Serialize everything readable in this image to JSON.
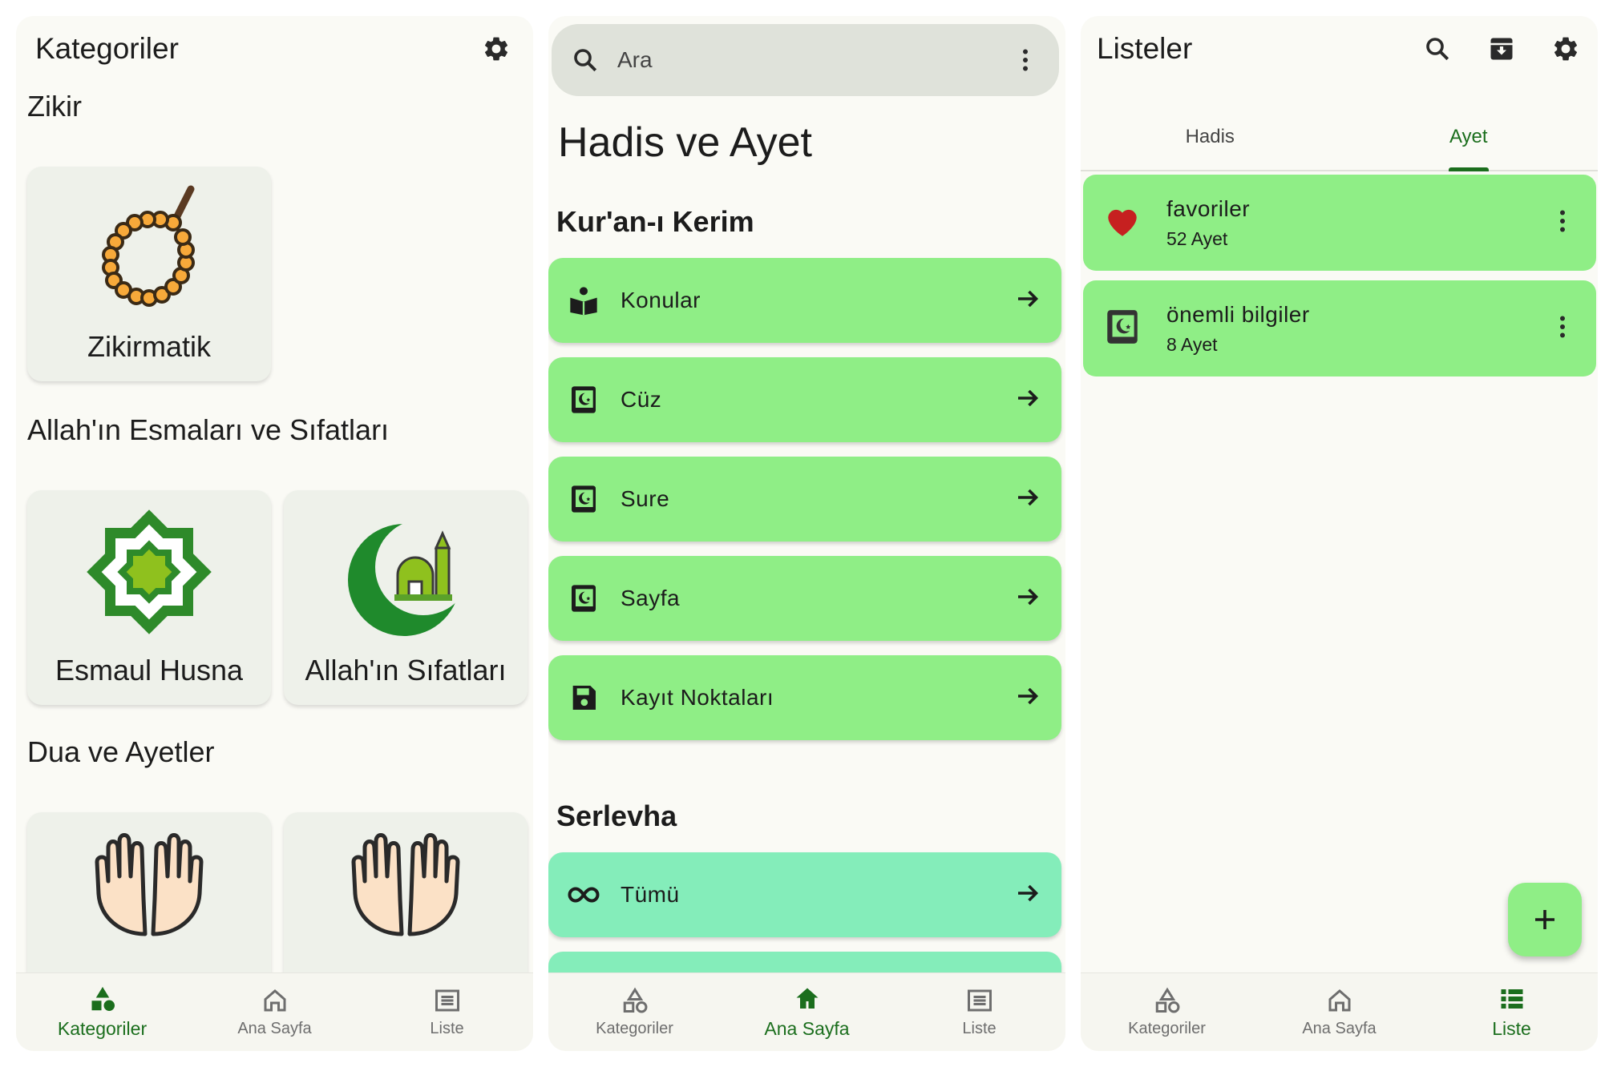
{
  "left": {
    "title": "Kategoriler",
    "sections": [
      {
        "title": "Zikir",
        "cards": [
          {
            "label": "Zikirmatik",
            "icon": "prayer-beads-icon"
          }
        ]
      },
      {
        "title": "Allah'ın Esmaları ve Sıfatları",
        "cards": [
          {
            "label": "Esmaul Husna",
            "icon": "islamic-star-icon"
          },
          {
            "label": "Allah'ın Sıfatları",
            "icon": "crescent-mosque-icon"
          }
        ]
      },
      {
        "title": "Dua ve Ayetler",
        "cards": [
          {
            "label": "",
            "icon": "praying-hands-icon"
          },
          {
            "label": "",
            "icon": "praying-hands-icon"
          }
        ]
      }
    ],
    "nav": [
      {
        "label": "Kategoriler",
        "icon": "shapes-icon",
        "active": true
      },
      {
        "label": "Ana Sayfa",
        "icon": "home-icon",
        "active": false
      },
      {
        "label": "Liste",
        "icon": "list-icon",
        "active": false
      }
    ]
  },
  "middle": {
    "search_placeholder": "Ara",
    "title": "Hadis ve Ayet",
    "section1": "Kur'an-ı Kerim",
    "items": [
      {
        "label": "Konular",
        "icon": "book-reader-icon"
      },
      {
        "label": "Cüz",
        "icon": "quran-icon"
      },
      {
        "label": "Sure",
        "icon": "quran-icon"
      },
      {
        "label": "Sayfa",
        "icon": "quran-icon"
      },
      {
        "label": "Kayıt Noktaları",
        "icon": "save-icon"
      }
    ],
    "section2": "Serlevha",
    "items2": [
      {
        "label": "Tümü",
        "icon": "infinity-icon"
      }
    ],
    "nav": [
      {
        "label": "Kategoriler",
        "icon": "shapes-icon",
        "active": false
      },
      {
        "label": "Ana Sayfa",
        "icon": "home-icon",
        "active": true
      },
      {
        "label": "Liste",
        "icon": "list-icon",
        "active": false
      }
    ]
  },
  "right": {
    "title": "Listeler",
    "tabs": [
      {
        "label": "Hadis",
        "active": false
      },
      {
        "label": "Ayet",
        "active": true
      }
    ],
    "lists": [
      {
        "name": "favoriler",
        "count": "52 Ayet",
        "icon": "heart-icon"
      },
      {
        "name": "önemli bilgiler",
        "count": "8 Ayet",
        "icon": "quran-icon"
      }
    ],
    "nav": [
      {
        "label": "Kategoriler",
        "icon": "shapes-icon",
        "active": false
      },
      {
        "label": "Ana Sayfa",
        "icon": "home-icon",
        "active": false
      },
      {
        "label": "Liste",
        "icon": "list-icon",
        "active": true
      }
    ]
  },
  "colors": {
    "accent": "#1b6e1d",
    "card_green": "#8fee86",
    "card_teal": "#84edba",
    "background": "#fafaf5",
    "heart": "#c62020"
  }
}
